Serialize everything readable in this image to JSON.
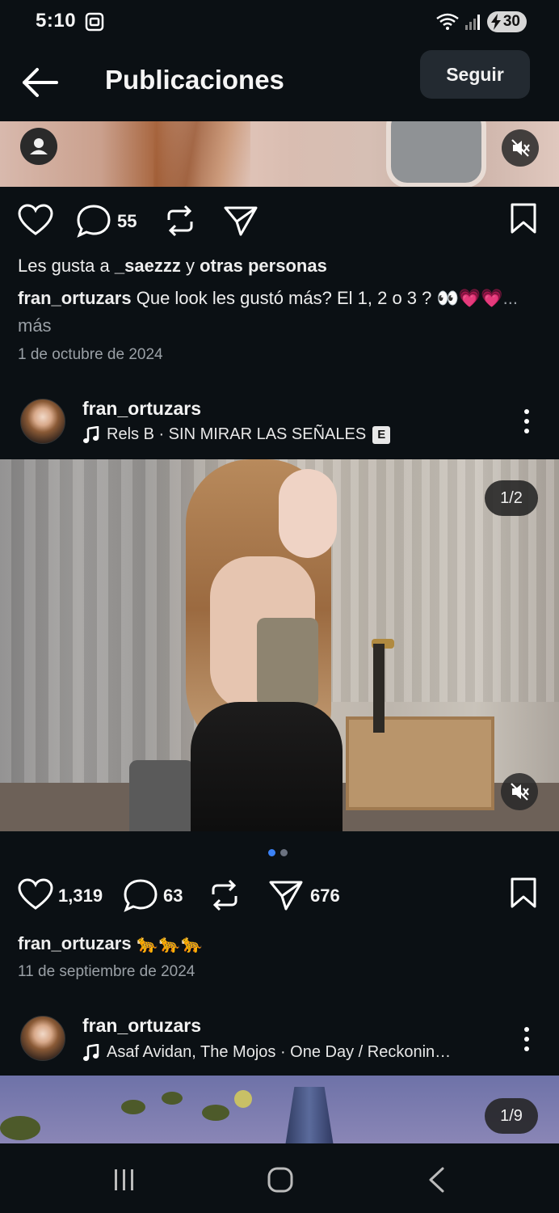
{
  "status": {
    "time": "5:10",
    "battery": "30"
  },
  "header": {
    "title": "Publicaciones",
    "follow_label": "Seguir"
  },
  "post1": {
    "comments": "55",
    "likes_prefix": "Les gusta a",
    "liker": "_saezzz",
    "likes_mid": "y",
    "likes_suffix": "otras personas",
    "author": "fran_ortuzars",
    "caption": "Que look les gustó más? El 1, 2 o 3 ? 👀💗💗",
    "more": "... más",
    "date": "1 de octubre de 2024"
  },
  "post2": {
    "author": "fran_ortuzars",
    "music": "Rels B · SIN MIRAR LAS SEÑALES",
    "explicit": "E",
    "page": "1/2",
    "likes": "1,319",
    "comments": "63",
    "shares": "676",
    "caption_author": "fran_ortuzars",
    "caption": "🐆🐆🐆",
    "date": "11 de septiembre de 2024"
  },
  "post3": {
    "author": "fran_ortuzars",
    "music": "Asaf Avidan, The Mojos · One Day / Reckonin…",
    "page": "1/9"
  },
  "colors": {
    "background": "#0b1014",
    "dot_active": "#3b82f6",
    "dot_inactive": "#6b7280",
    "muted_text": "#9aa0a6"
  },
  "icons": [
    "back-arrow-icon",
    "heart-icon",
    "comment-icon",
    "repost-icon",
    "send-icon",
    "bookmark-icon",
    "mute-icon",
    "music-note-icon",
    "more-vert-icon",
    "user-icon"
  ]
}
